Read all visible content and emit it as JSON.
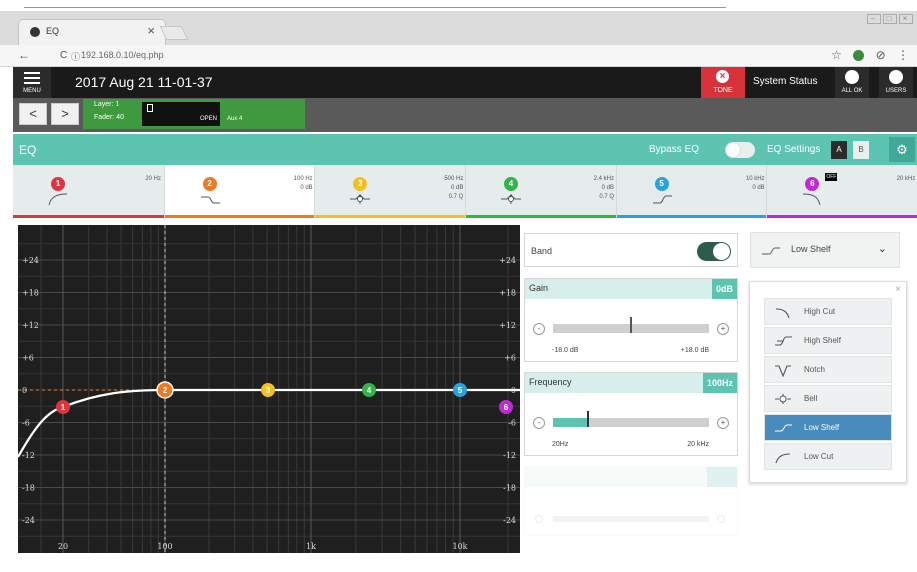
{
  "browser": {
    "tab_title": "EQ",
    "tab_close": "×",
    "url": "192.168.0.10/eq.php",
    "back": "←",
    "reload": "C",
    "info": "ⓘ",
    "star": "☆"
  },
  "header": {
    "menu_label": "MENU",
    "datetime": "2017 Aug 21 11-01-37",
    "tone_label": "TONE",
    "system_status": "System Status",
    "all_ok": "ALL OK",
    "users": "USERS"
  },
  "layer": {
    "prev": "<",
    "next": ">",
    "layer_text": "Layer: 1",
    "fader_text": "Fader: 40",
    "open": "OPEN",
    "aux": "Aux 4"
  },
  "eq": {
    "title": "EQ",
    "bypass_label": "Bypass EQ",
    "settings_label": "EQ Settings",
    "a_label": "A",
    "b_label": "B"
  },
  "bands": [
    {
      "num": "1",
      "color": "#e0353e",
      "lines": [
        "20 Hz",
        "",
        ""
      ]
    },
    {
      "num": "2",
      "color": "#f07a24",
      "lines": [
        "100 Hz",
        "0 dB",
        ""
      ]
    },
    {
      "num": "3",
      "color": "#f4c020",
      "lines": [
        "500 Hz",
        "0 dB",
        "0.7 Q"
      ]
    },
    {
      "num": "4",
      "color": "#33b44a",
      "lines": [
        "2.4 kHz",
        "0 dB",
        "0.7 Q"
      ]
    },
    {
      "num": "5",
      "color": "#2aa3dd",
      "lines": [
        "10 kHz",
        "0 dB",
        ""
      ]
    },
    {
      "num": "6",
      "color": "#c02ad6",
      "lines": [
        "20 kHz",
        "",
        ""
      ],
      "off": "OFF"
    }
  ],
  "graph": {
    "y_ticks_left": [
      "+24",
      "+18",
      "+12",
      "+6",
      "0",
      "-6",
      "-12",
      "-18",
      "-24"
    ],
    "y_ticks_right": [
      "+24",
      "+18",
      "+12",
      "+6",
      "0",
      "-6",
      "-12",
      "-18",
      "-24"
    ],
    "x_ticks": [
      "20",
      "100",
      "1k",
      "10k"
    ],
    "points": [
      "1",
      "2",
      "3",
      "4",
      "5",
      "6"
    ]
  },
  "controls": {
    "band_label": "Band",
    "gain_label": "Gain",
    "gain_value": "0dB",
    "gain_min": "-18.0 dB",
    "gain_max": "+18.0 dB",
    "freq_label": "Frequency",
    "freq_value": "100Hz",
    "freq_min": "20Hz",
    "freq_max": "20 kHz",
    "minus": "-",
    "plus": "+"
  },
  "filter": {
    "selected": "Low Shelf",
    "close": "×",
    "options": [
      "High Cut",
      "High Shelf",
      "Notch",
      "Bell",
      "Low Shelf",
      "Low Cut"
    ],
    "selected_index": 4
  }
}
